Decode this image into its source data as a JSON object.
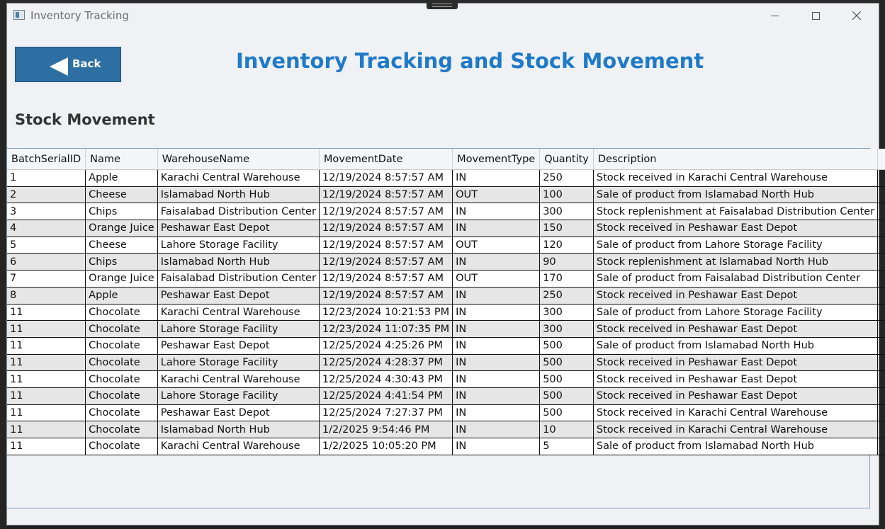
{
  "window": {
    "title": "Inventory Tracking",
    "controls": {
      "minimize": "minimize",
      "maximize": "maximize",
      "close": "close"
    }
  },
  "header": {
    "back_label": "Back",
    "title": "Inventory Tracking and Stock Movement"
  },
  "section": {
    "title": "Stock Movement"
  },
  "table": {
    "columns": [
      "BatchSerialID",
      "Name",
      "WarehouseName",
      "MovementDate",
      "MovementType",
      "Quantity",
      "Description"
    ],
    "rows": [
      [
        "1",
        "Apple",
        "Karachi Central Warehouse",
        "12/19/2024 8:57:57 AM",
        "IN",
        "250",
        "Stock received in Karachi Central Warehouse"
      ],
      [
        "2",
        "Cheese",
        "Islamabad North Hub",
        "12/19/2024 8:57:57 AM",
        "OUT",
        "100",
        "Sale of product from Islamabad North Hub"
      ],
      [
        "3",
        "Chips",
        "Faisalabad Distribution Center",
        "12/19/2024 8:57:57 AM",
        "IN",
        "300",
        "Stock replenishment at Faisalabad Distribution Center"
      ],
      [
        "4",
        "Orange Juice",
        "Peshawar East Depot",
        "12/19/2024 8:57:57 AM",
        "IN",
        "150",
        "Stock received in Peshawar East Depot"
      ],
      [
        "5",
        "Cheese",
        "Lahore Storage Facility",
        "12/19/2024 8:57:57 AM",
        "OUT",
        "120",
        "Sale of product from Lahore Storage Facility"
      ],
      [
        "6",
        "Chips",
        "Islamabad North Hub",
        "12/19/2024 8:57:57 AM",
        "IN",
        "90",
        "Stock replenishment at Islamabad North Hub"
      ],
      [
        "7",
        "Orange Juice",
        "Faisalabad Distribution Center",
        "12/19/2024 8:57:57 AM",
        "OUT",
        "170",
        "Sale of product from Faisalabad Distribution Center"
      ],
      [
        "8",
        "Apple",
        "Peshawar East Depot",
        "12/19/2024 8:57:57 AM",
        "IN",
        "250",
        "Stock received in Peshawar East Depot"
      ],
      [
        "11",
        "Chocolate",
        "Karachi Central Warehouse",
        "12/23/2024 10:21:53 PM",
        "IN",
        "300",
        "Sale of product from Lahore Storage Facility"
      ],
      [
        "11",
        "Chocolate",
        "Lahore Storage Facility",
        "12/23/2024 11:07:35 PM",
        "IN",
        "300",
        "Stock received in Peshawar East Depot"
      ],
      [
        "11",
        "Chocolate",
        "Peshawar East Depot",
        "12/25/2024 4:25:26 PM",
        "IN",
        "500",
        "Sale of product from Islamabad North Hub"
      ],
      [
        "11",
        "Chocolate",
        "Lahore Storage Facility",
        "12/25/2024 4:28:37 PM",
        "IN",
        "500",
        "Stock received in Peshawar East Depot"
      ],
      [
        "11",
        "Chocolate",
        "Karachi Central Warehouse",
        "12/25/2024 4:30:43 PM",
        "IN",
        "500",
        "Stock received in Peshawar East Depot"
      ],
      [
        "11",
        "Chocolate",
        "Lahore Storage Facility",
        "12/25/2024 4:41:54 PM",
        "IN",
        "500",
        "Stock received in Peshawar East Depot"
      ],
      [
        "11",
        "Chocolate",
        "Peshawar East Depot",
        "12/25/2024 7:27:37 PM",
        "IN",
        "500",
        "Stock received in Karachi Central Warehouse"
      ],
      [
        "11",
        "Chocolate",
        "Islamabad North Hub",
        "1/2/2025 9:54:46 PM",
        "IN",
        "10",
        "Stock received in Karachi Central Warehouse"
      ],
      [
        "11",
        "Chocolate",
        "Karachi Central Warehouse",
        "1/2/2025 10:05:20 PM",
        "IN",
        "5",
        "Sale of product from Islamabad North Hub"
      ]
    ]
  },
  "colors": {
    "title_blue": "#1f7ac8",
    "back_button": "#2d6fa3",
    "window_bg": "#f0f1f4"
  }
}
